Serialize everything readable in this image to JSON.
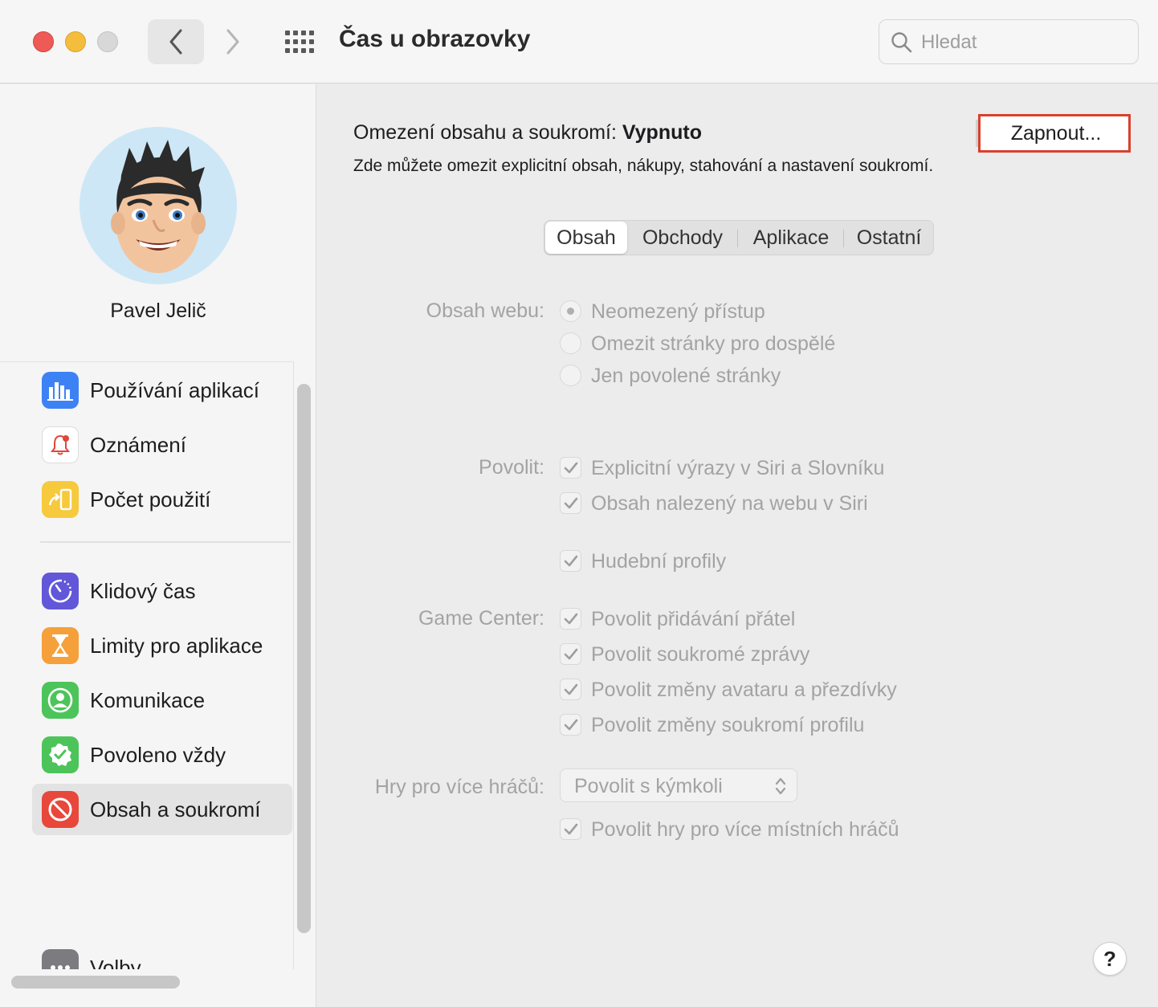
{
  "window": {
    "title": "Čas u obrazovky",
    "search_placeholder": "Hledat"
  },
  "sidebar": {
    "user_name": "Pavel Jelič",
    "items": [
      {
        "label": "Používání aplikací",
        "icon": "bar-chart-icon",
        "color": "#3d82f5"
      },
      {
        "label": "Oznámení",
        "icon": "bell-icon",
        "color": "#ffffff"
      },
      {
        "label": "Počet použití",
        "icon": "pickup-icon",
        "color": "#f7c93c"
      },
      {
        "label": "Klidový čas",
        "icon": "downtime-icon",
        "color": "#6257d8"
      },
      {
        "label": "Limity pro aplikace",
        "icon": "hourglass-icon",
        "color": "#f5a03a"
      },
      {
        "label": "Komunikace",
        "icon": "contact-icon",
        "color": "#4cc45a"
      },
      {
        "label": "Povoleno vždy",
        "icon": "checkmark-badge-icon",
        "color": "#4cc45a"
      },
      {
        "label": "Obsah a soukromí",
        "icon": "restriction-icon",
        "color": "#e8473c"
      },
      {
        "label": "Volby",
        "icon": "more-icon",
        "color": "#7b7b80"
      }
    ],
    "selected_index": 7
  },
  "main": {
    "status_label": "Omezení obsahu a soukromí:",
    "status_value": "Vypnuto",
    "description": "Zde můžete omezit explicitní obsah, nákupy, stahování a nastavení soukromí.",
    "enable_button": "Zapnout...",
    "tabs": [
      "Obsah",
      "Obchody",
      "Aplikace",
      "Ostatní"
    ],
    "active_tab": "Obsah",
    "web_content": {
      "label": "Obsah webu:",
      "options": [
        "Neomezený přístup",
        "Omezit stránky pro dospělé",
        "Jen povolené stránky"
      ],
      "selected": "Neomezený přístup"
    },
    "allow": {
      "label": "Povolit:",
      "options": [
        {
          "text": "Explicitní výrazy v Siri a Slovníku",
          "checked": true
        },
        {
          "text": "Obsah nalezený na webu v Siri",
          "checked": true
        },
        {
          "text": "Hudební profily",
          "checked": true
        }
      ]
    },
    "game_center": {
      "label": "Game Center:",
      "options": [
        {
          "text": "Povolit přidávání přátel",
          "checked": true
        },
        {
          "text": "Povolit soukromé zprávy",
          "checked": true
        },
        {
          "text": "Povolit změny avataru a přezdívky",
          "checked": true
        },
        {
          "text": "Povolit změny soukromí profilu",
          "checked": true
        }
      ]
    },
    "multiplayer": {
      "label": "Hry pro více hráčů:",
      "value": "Povolit s kýmkoli",
      "local_option": {
        "text": "Povolit hry pro více místních hráčů",
        "checked": true
      }
    },
    "help": "?"
  }
}
